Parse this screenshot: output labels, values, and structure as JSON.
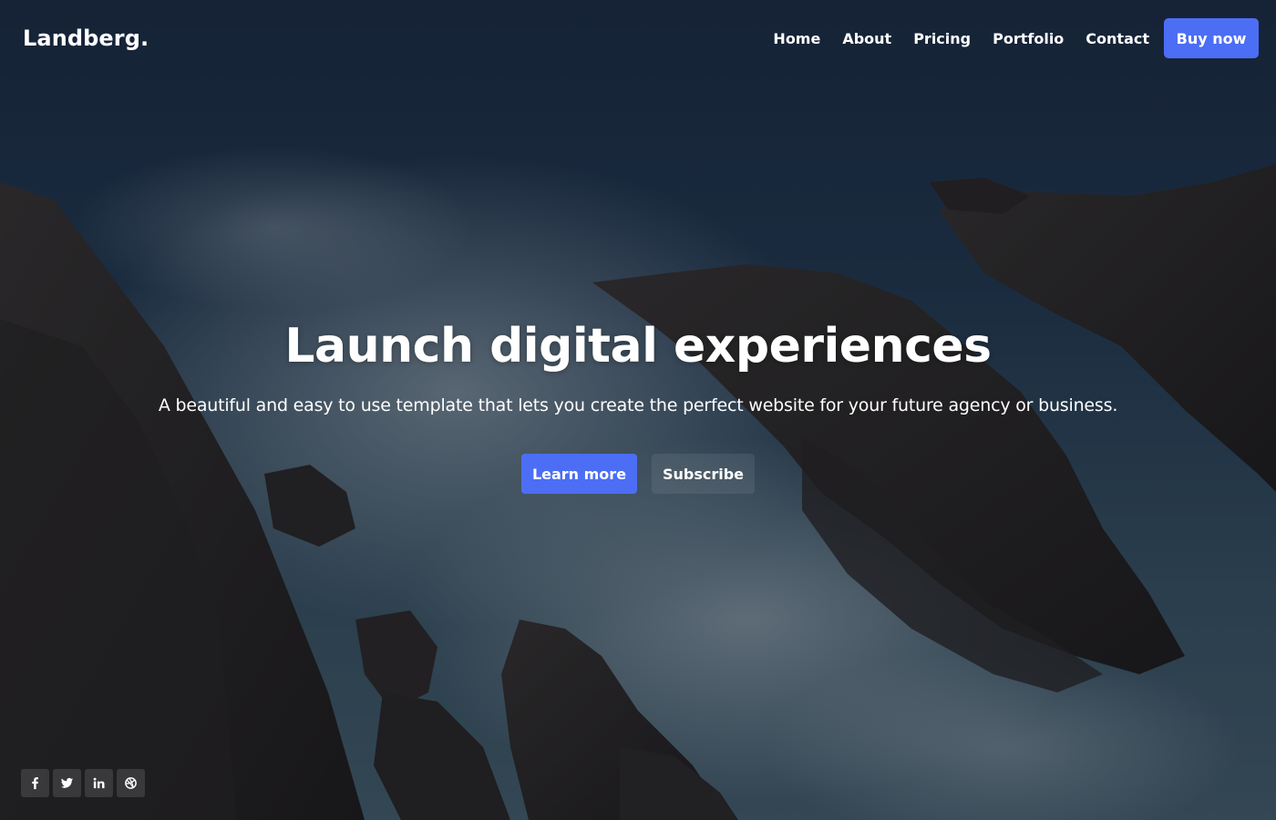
{
  "brand": {
    "name": "Landberg."
  },
  "nav": {
    "items": [
      {
        "label": "Home"
      },
      {
        "label": "About"
      },
      {
        "label": "Pricing"
      },
      {
        "label": "Portfolio"
      },
      {
        "label": "Contact"
      }
    ],
    "cta_label": "Buy now"
  },
  "hero": {
    "title": "Launch digital experiences",
    "subtitle": "A beautiful and easy to use template that lets you create the perfect website for your future agency or business.",
    "primary_label": "Learn more",
    "secondary_label": "Subscribe"
  },
  "social": {
    "icons": [
      "facebook-icon",
      "twitter-icon",
      "linkedin-icon",
      "dribbble-icon"
    ]
  },
  "colors": {
    "accent": "#4c6ef5",
    "text": "#ffffff"
  }
}
